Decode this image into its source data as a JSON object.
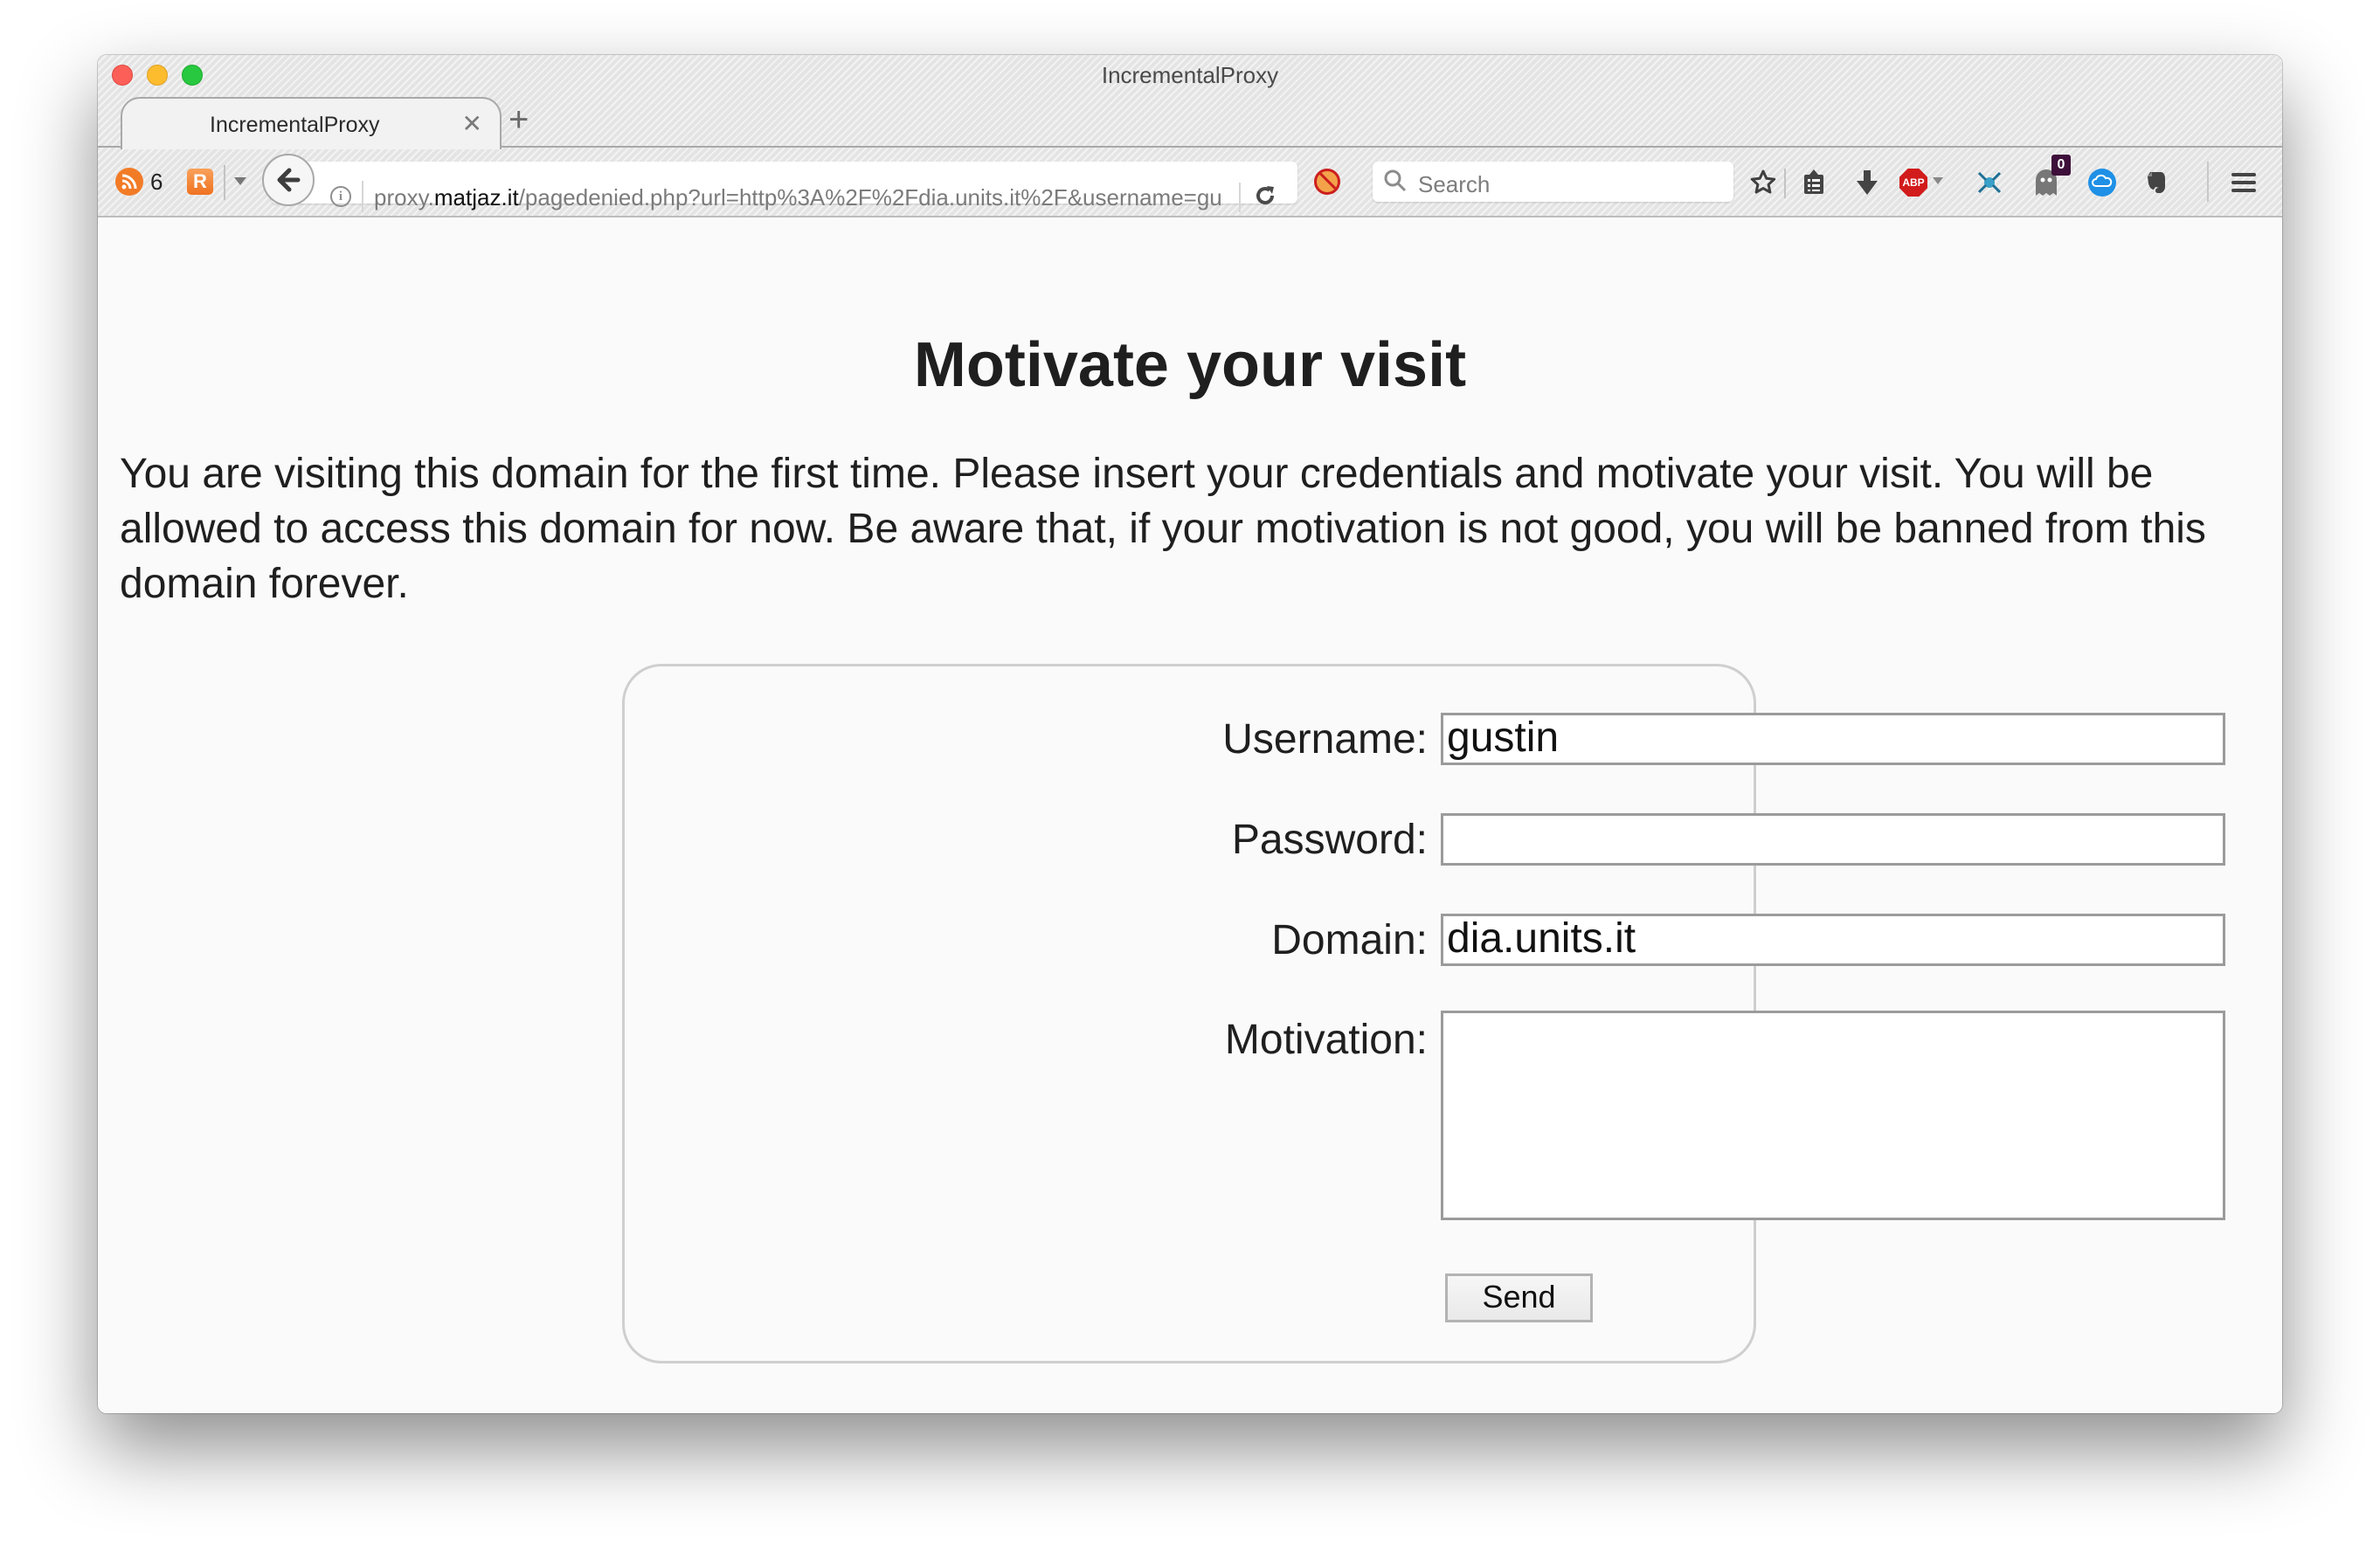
{
  "window": {
    "title": "IncrementalProxy"
  },
  "tabs": [
    {
      "label": "IncrementalProxy",
      "active": true
    }
  ],
  "toolbar": {
    "rss_count": "6",
    "url_host": "proxy.matjaz.it",
    "url_prefix": "proxy.",
    "url_host_bold": "matjaz.it",
    "url_path": "/pagedenied.php?url=http%3A%2F%2Fdia.units.it%2F&username=gu",
    "search_placeholder": "Search",
    "abp_label": "ABP",
    "ghostery_badge": "0",
    "icons": [
      "rss-icon",
      "r-extension-icon",
      "back-icon",
      "info-icon",
      "reload-icon",
      "blocked-extension-icon",
      "search-icon",
      "bookmark-star-icon",
      "reading-list-icon",
      "download-icon",
      "adblock-plus-icon",
      "network-extension-icon",
      "ghostery-icon",
      "cloud-extension-icon",
      "evernote-icon",
      "hamburger-menu-icon"
    ]
  },
  "page": {
    "heading": "Motivate your visit",
    "intro": "You are visiting this domain for the first time. Please insert your credentials and motivate your visit. You will be allowed to access this domain for now. Be aware that, if your motivation is not good, you will be banned from this domain forever.",
    "form": {
      "username_label": "Username:",
      "username_value": "gustin",
      "password_label": "Password:",
      "password_value": "",
      "domain_label": "Domain:",
      "domain_value": "dia.units.it",
      "motivation_label": "Motivation:",
      "motivation_value": "",
      "send_label": "Send"
    }
  }
}
